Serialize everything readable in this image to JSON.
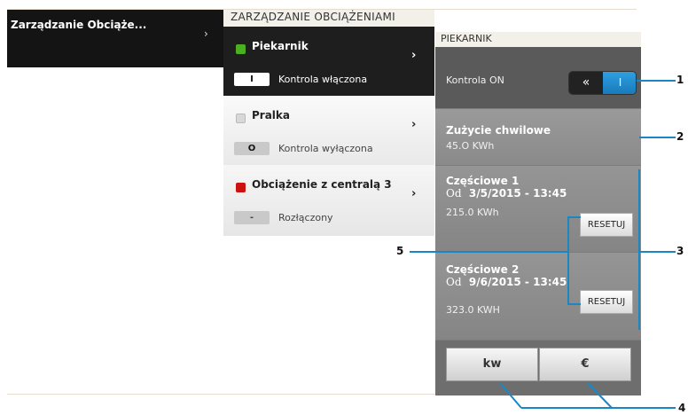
{
  "left_menu": {
    "title": "Zarządzanie Obciąże...",
    "chevron": "›"
  },
  "mid": {
    "header": "ZARZĄDZANIE OBCIĄŻENIAMI",
    "items": [
      {
        "name": "Piekarnik",
        "badge": "I",
        "status": "Kontrola włączona",
        "color": "#4caf22",
        "chevron": "›"
      },
      {
        "name": "Pralka",
        "badge": "O",
        "status": "Kontrola wyłączona",
        "color": "#d8d8d8",
        "chevron": "›"
      },
      {
        "name": "Obciążenie z centralą 3",
        "badge": "-",
        "status": "Rozłączony",
        "color": "#cc1111",
        "chevron": "›"
      }
    ]
  },
  "panel": {
    "header": "PIEKARNIK",
    "control_label": "Kontrola ON",
    "toggle_left": "«",
    "toggle_right": "I",
    "usage_title": "Zużycie chwilowe",
    "usage_value": "45.O KWh",
    "partial1": {
      "title": "Częściowe 1",
      "od": "Od",
      "date": "3/5/2015 - 13:45",
      "value": "215.0 KWh",
      "reset": "RESETUJ"
    },
    "partial2": {
      "title": "Częściowe 2",
      "od": "Od",
      "date": "9/6/2015 - 13:45",
      "value": "323.0 KWH",
      "reset": "RESETUJ"
    },
    "btn_kw": "kw",
    "btn_eur": "€"
  },
  "callouts": {
    "n1": "1",
    "n2": "2",
    "n3": "3",
    "n4": "4",
    "n5": "5"
  },
  "colors": {
    "accent": "#1a87c4"
  }
}
